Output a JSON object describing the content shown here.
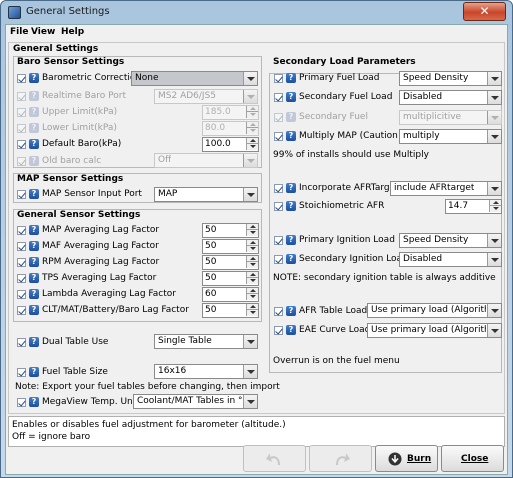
{
  "window": {
    "title": "General Settings",
    "close": "✕"
  },
  "menu": {
    "file": "File",
    "view": "View",
    "help": "Help"
  },
  "section_title": "General Settings",
  "baro": {
    "title": "Baro Sensor Settings",
    "barometric_correction": {
      "label": "Barometric Correction",
      "value": "None"
    },
    "realtime_baro_port": {
      "label": "Realtime Baro Port",
      "value": "MS2 AD6/JS5"
    },
    "upper_limit": {
      "label": "Upper Limit(kPa)",
      "value": "185.0"
    },
    "lower_limit": {
      "label": "Lower Limit(kPa)",
      "value": "80.0"
    },
    "default_baro": {
      "label": "Default Baro(kPa)",
      "value": "100.0"
    },
    "old_baro_calc": {
      "label": "Old baro calc",
      "value": "Off"
    }
  },
  "map": {
    "title": "MAP Sensor Settings",
    "input_port": {
      "label": "MAP Sensor Input Port",
      "value": "MAP"
    }
  },
  "sensors": {
    "title": "General Sensor Settings",
    "map_lag": {
      "label": "MAP Averaging Lag Factor",
      "value": "50"
    },
    "maf_lag": {
      "label": "MAF Averaging Lag Factor",
      "value": "50"
    },
    "rpm_lag": {
      "label": "RPM Averaging Lag Factor",
      "value": "50"
    },
    "tps_lag": {
      "label": "TPS Averaging Lag Factor",
      "value": "50"
    },
    "lambda_lag": {
      "label": "Lambda Averaging Lag Factor",
      "value": "60"
    },
    "clt_lag": {
      "label": "CLT/MAT/Battery/Baro Lag Factor",
      "value": "50"
    }
  },
  "dual_table": {
    "label": "Dual Table Use",
    "value": "Single Table"
  },
  "fuel_table_size": {
    "label": "Fuel Table Size",
    "value": "16x16"
  },
  "fuel_note": "Note: Export your fuel tables before changing, then import",
  "megaview": {
    "label": "MegaView Temp. Units",
    "value": "Coolant/MAT Tables in °C"
  },
  "secondary": {
    "title": "Secondary Load Parameters",
    "primary_fuel_load": {
      "label": "Primary Fuel Load",
      "value": "Speed Density"
    },
    "secondary_fuel_load": {
      "label": "Secondary Fuel Load",
      "value": "Disabled"
    },
    "secondary_fuel": {
      "label": "Secondary Fuel",
      "value": "multiplicitive"
    },
    "multiply_map": {
      "label": "Multiply MAP (Caution!)",
      "value": "multiply"
    },
    "multiply_note": "99% of installs should use Multiply",
    "incorporate_afr": {
      "label": "Incorporate AFRTarget",
      "value": "include AFRtarget"
    },
    "stoich": {
      "label": "Stoichiometric AFR",
      "value": "14.7"
    },
    "primary_ign_load": {
      "label": "Primary Ignition Load",
      "value": "Speed Density"
    },
    "secondary_ign_load": {
      "label": "Secondary Ignition Load",
      "value": "Disabled"
    },
    "ign_note": "NOTE: secondary ignition table is always additive",
    "afr_table_load": {
      "label": "AFR Table Load",
      "value": "Use primary load (Algorithm)"
    },
    "eae_curve_load": {
      "label": "EAE Curve Load",
      "value": "Use primary load (Algorithm)"
    },
    "overrun_note": "Overrun is on the fuel menu"
  },
  "description": {
    "line1": "Enables or disables fuel adjustment for barometer (altitude.)",
    "line2": "Off = ignore baro"
  },
  "buttons": {
    "burn": "Burn",
    "close": "Close"
  }
}
